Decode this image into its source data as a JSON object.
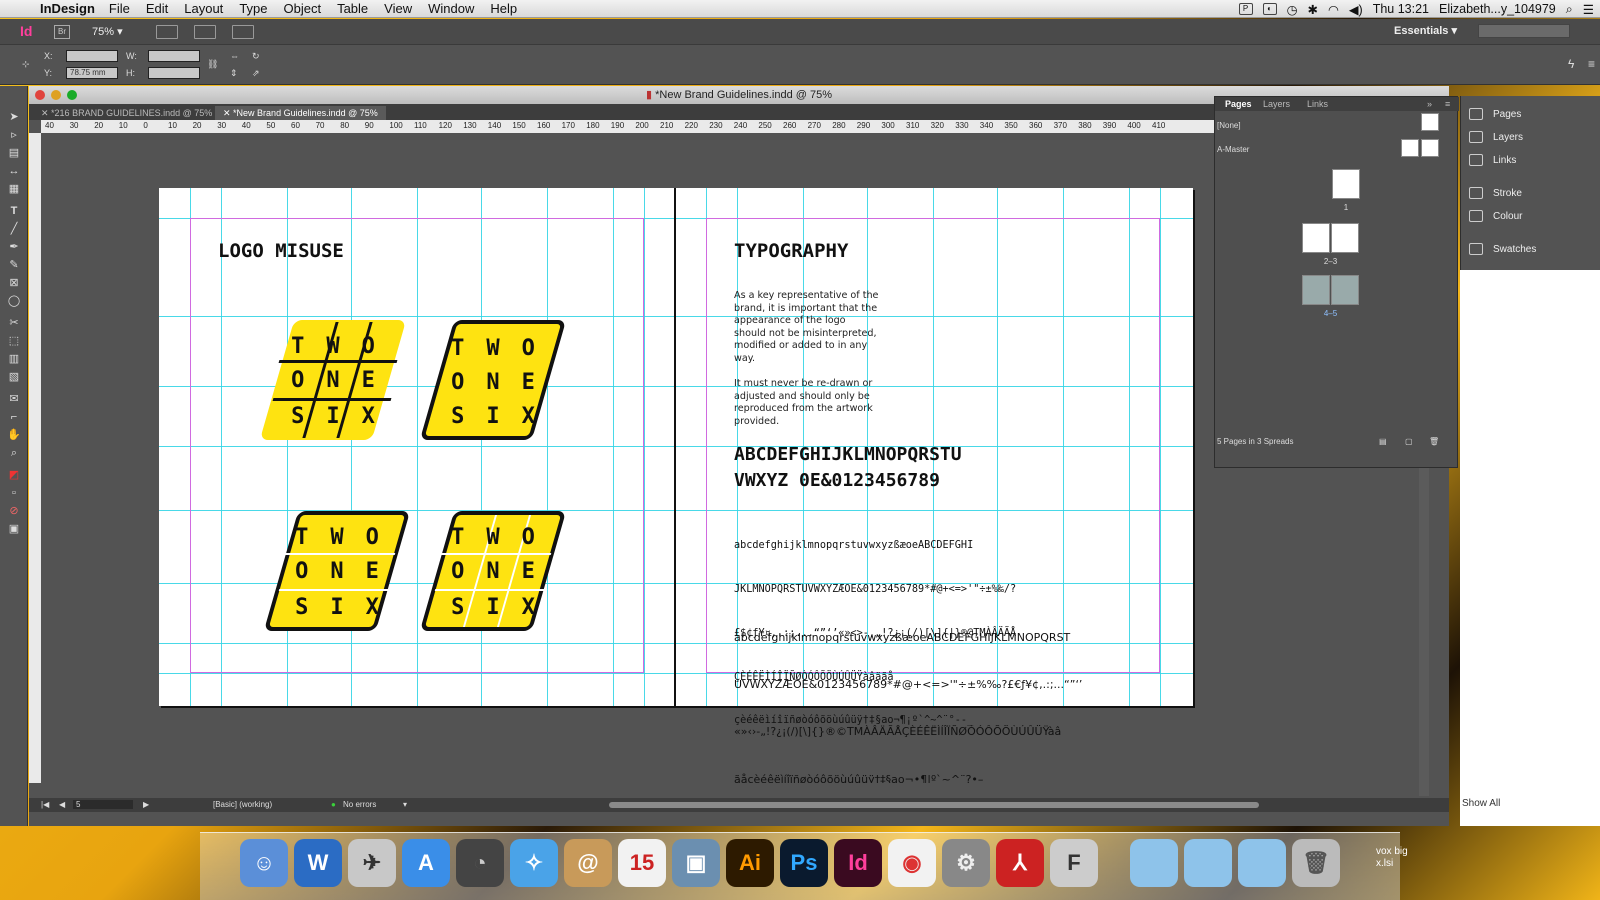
{
  "menubar": {
    "app_name": "InDesign",
    "menus": [
      "File",
      "Edit",
      "Layout",
      "Type",
      "Object",
      "Table",
      "View",
      "Window",
      "Help"
    ],
    "clock": "Thu 13:21",
    "user": "Elizabeth...y_104979"
  },
  "appbar": {
    "app_logo": "Id",
    "bridge_logo": "Br",
    "zoom": "75%",
    "workspace": "Essentials"
  },
  "control": {
    "x_label": "X:",
    "y_label": "Y:",
    "w_label": "W:",
    "h_label": "H:",
    "y_value": "78.75 mm"
  },
  "document": {
    "window_title": "*New Brand Guidelines.indd @ 75%",
    "tabs": [
      {
        "label": "*216 BRAND GUIDELINES.indd @ 75%",
        "active": false
      },
      {
        "label": "*New Brand Guidelines.indd @ 75%",
        "active": true
      }
    ],
    "ruler_ticks": [
      "40",
      "30",
      "20",
      "10",
      "0",
      "10",
      "20",
      "30",
      "40",
      "50",
      "60",
      "70",
      "80",
      "90",
      "100",
      "110",
      "120",
      "130",
      "140",
      "150",
      "160",
      "170",
      "180",
      "190",
      "200",
      "210",
      "220",
      "230",
      "240",
      "250",
      "260",
      "270",
      "280",
      "290",
      "300",
      "310",
      "320",
      "330",
      "340",
      "350",
      "360",
      "370",
      "380",
      "390",
      "400",
      "410"
    ]
  },
  "left_page": {
    "heading": "LOGO MISUSE",
    "logo_letters": [
      [
        "T",
        "W",
        "O"
      ],
      [
        "O",
        "N",
        "E"
      ],
      [
        "S",
        "I",
        "X"
      ]
    ]
  },
  "right_page": {
    "heading": "TYPOGRAPHY",
    "para1": "As a key representative of the brand, it is important that the appearance of the logo should not be misinterpreted, modified or added to in any way.",
    "para2": "It must never be re-drawn or adjusted and should only be reproduced from the artwork provided.",
    "glyph_big_line1": "ABCDEFGHIJKLMNOPQRSTU",
    "glyph_big_line2": "VWXYZ 0E&0123456789",
    "glyph_small_lines": [
      "abcdefghijklmnopqrstuvwxyzßæoeABCDEFGHI",
      "JKLMNOPQRSTUVWXYZÆOE&0123456789*#@+<=>'\"÷±%‰/?",
      "£$¢ƒ¥¤,.:;...“”‘’«»<>-,„!?¿¡(/)[\\]{|}®@TMÀÂÄÃÅ",
      "ÇÈÉÊËÌÍÎÏÑØÒÓÔÕÖÙÚÛÜŸàâäãå",
      "çèéêëìíîïñøòóôõöùúûüÿ†‡§ao¬¶¡º`^~^¨°--_"
    ],
    "glyph_regular_lines": [
      "abcdefghijklmnopqrstuvwxyzßæoeABCDEFGHIJKLMNOPQRST",
      "UVWXYZÆOE&0123456789*#@+<=>'\"÷±%‰?£€ƒ¥¢,.:;...“”‘’",
      "«»‹›-„!?¿¡(/)[\\]{}®©TMÀÂÄÃÅÇÈÉÊËÌÍÎÏÑØÒÓÔÕÖÙÚÛÜŸàâ",
      "ãåçèéêëìíîïñøòóôõöùúûüÿ†‡§ao¬•¶|º`~^¨?•–_"
    ]
  },
  "statusbar": {
    "page": "5",
    "profile": "[Basic] (working)",
    "errors": "No errors"
  },
  "pages_panel": {
    "tabs": [
      "Pages",
      "Layers",
      "Links"
    ],
    "none_label": "[None]",
    "master_label": "A-Master",
    "page_labels": [
      "1",
      "2–3",
      "4–5"
    ],
    "footer": "5 Pages in 3 Spreads"
  },
  "right_dock": {
    "items": [
      {
        "label": "Pages",
        "icon": "pages-icon"
      },
      {
        "label": "Layers",
        "icon": "layers-icon"
      },
      {
        "label": "Links",
        "icon": "links-icon"
      },
      {
        "label": "Stroke",
        "icon": "stroke-icon"
      },
      {
        "label": "Colour",
        "icon": "colour-icon"
      },
      {
        "label": "Swatches",
        "icon": "swatches-icon"
      }
    ],
    "show_all": "Show All"
  },
  "dock_apps": [
    {
      "name": "Finder",
      "glyph": "☺"
    },
    {
      "name": "Word",
      "glyph": "W"
    },
    {
      "name": "Launchpad",
      "glyph": "✈"
    },
    {
      "name": "App Store",
      "glyph": "A"
    },
    {
      "name": "Dashboard",
      "glyph": "◔"
    },
    {
      "name": "Safari",
      "glyph": "✧"
    },
    {
      "name": "Contacts",
      "glyph": "@"
    },
    {
      "name": "Calendar",
      "glyph": "15"
    },
    {
      "name": "iPhoto",
      "glyph": "▣"
    },
    {
      "name": "Illustrator",
      "glyph": "Ai"
    },
    {
      "name": "Photoshop",
      "glyph": "Ps"
    },
    {
      "name": "InDesign",
      "glyph": "Id"
    },
    {
      "name": "Chrome",
      "glyph": "◉"
    },
    {
      "name": "System Preferences",
      "glyph": "⚙"
    },
    {
      "name": "Acrobat",
      "glyph": "⅄"
    },
    {
      "name": "Font Book",
      "glyph": "F"
    }
  ],
  "desktop_labels": [
    "vox big",
    "x.lsi"
  ],
  "colors": {
    "logo_yellow": "#fee311",
    "guide_cyan": "#35d5e6",
    "margin_magenta": "#d06ae0",
    "panel_gray": "#535353"
  }
}
